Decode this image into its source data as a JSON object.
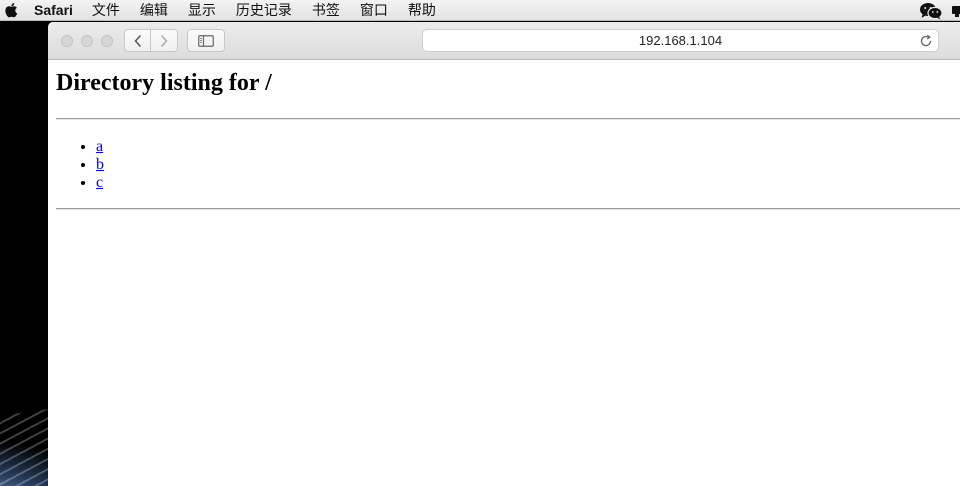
{
  "menubar": {
    "app_name": "Safari",
    "items": [
      "文件",
      "编辑",
      "显示",
      "历史记录",
      "书签",
      "窗口",
      "帮助"
    ]
  },
  "toolbar": {
    "address": "192.168.1.104"
  },
  "page": {
    "title": "Directory listing for /",
    "entries": [
      "a",
      "b",
      "c"
    ]
  },
  "colors": {
    "link": "#0000ee",
    "menubar_bg": "#e8e8e8",
    "toolbar_bg": "#e2e2e2"
  }
}
